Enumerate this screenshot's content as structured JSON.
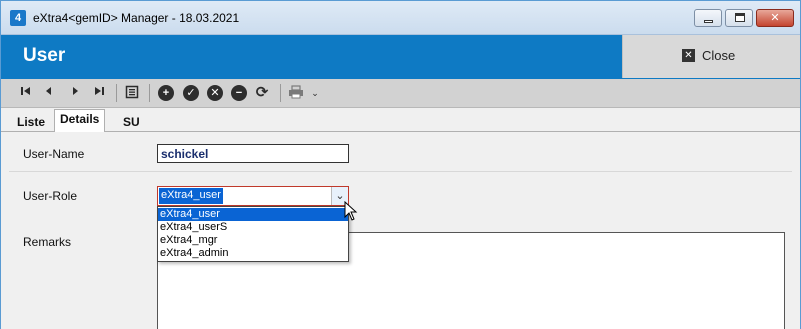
{
  "window": {
    "app_icon_label": "4",
    "title": "eXtra4<gemID> Manager - 18.03.2021"
  },
  "header": {
    "title": "User",
    "close_label": "Close"
  },
  "toolbar": {
    "buttons": [
      {
        "name": "first-record-icon",
        "glyph": "⏮"
      },
      {
        "name": "previous-record-icon",
        "glyph": "◀"
      },
      {
        "name": "next-record-icon",
        "glyph": "▶"
      },
      {
        "name": "last-record-icon",
        "glyph": "⏭"
      },
      {
        "name": "list-view-icon",
        "glyph": "▤"
      },
      {
        "name": "add-record-icon",
        "glyph": "+"
      },
      {
        "name": "save-record-icon",
        "glyph": "✓"
      },
      {
        "name": "cancel-edit-icon",
        "glyph": "✕"
      },
      {
        "name": "delete-record-icon",
        "glyph": "−"
      },
      {
        "name": "refresh-icon",
        "glyph": "⟳"
      },
      {
        "name": "print-icon",
        "glyph": "⎙"
      }
    ]
  },
  "tabs": [
    {
      "label": "Liste",
      "active": false
    },
    {
      "label": "Details",
      "active": true
    },
    {
      "label": "SU",
      "active": false
    }
  ],
  "form": {
    "username_label": "User-Name",
    "username_value": "schickel",
    "role_label": "User-Role",
    "role_value": "eXtra4_user",
    "role_options": [
      "eXtra4_user",
      "eXtra4_userS",
      "eXtra4_mgr",
      "eXtra4_admin"
    ],
    "role_selected_index": 0,
    "remarks_label": "Remarks",
    "remarks_value": ""
  },
  "colors": {
    "header_blue": "#0e7ac4",
    "selection_blue": "#0a64d4",
    "focus_border_red": "#c0392b"
  }
}
